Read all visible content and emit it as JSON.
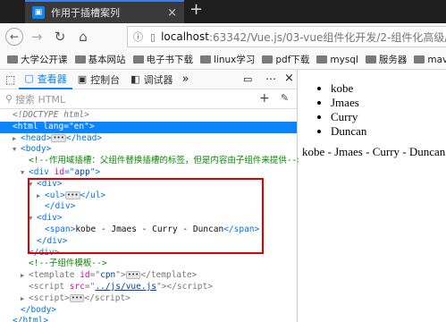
{
  "browser": {
    "tab_title": "作用于插槽案列",
    "tab_close": "×",
    "new_tab": "+",
    "url_host": "localhost",
    "url_rest": ":63342/Vue.js/03-vue组件化开发/2-组件化高级/03-作",
    "bookmarks": [
      "大学公开课",
      "基本网站",
      "电子书下载",
      "linux学习",
      "pdf下载",
      "mysql",
      "服务器",
      "maven"
    ]
  },
  "devtools": {
    "tabs": [
      "查看器",
      "控制台",
      "调试器"
    ],
    "more": "»",
    "search_placeholder": "搜索 HTML",
    "add_label": "+",
    "tree": {
      "doctype": "<!DOCTYPE html>",
      "html_lang": "en",
      "comment1": "<!--作用域插槽：父组件替换插槽的标签，但是内容由子组件来提供-->",
      "app_id": "app",
      "span_text": "kobe - Jmaes - Curry - Duncan",
      "comment2": "<!--子组件模板-->",
      "template_id": "cpn",
      "script_src": "../js/vue.js"
    }
  },
  "page": {
    "list_items": [
      "kobe",
      "Jmaes",
      "Curry",
      "Duncan"
    ],
    "span_text": "kobe - Jmaes - Curry - Duncan"
  }
}
